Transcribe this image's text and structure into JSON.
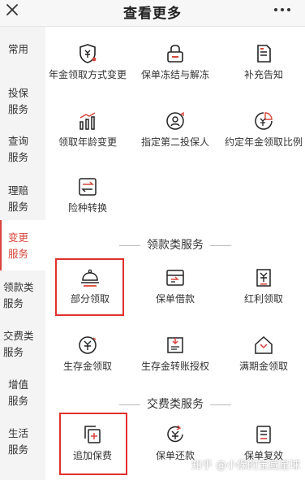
{
  "header": {
    "title": "查看更多"
  },
  "sidebar": {
    "items": [
      {
        "label": "常用"
      },
      {
        "label": "投保服务"
      },
      {
        "label": "查询服务"
      },
      {
        "label": "理赔服务"
      },
      {
        "label": "变更服务",
        "active": true
      },
      {
        "label": "领款类服务"
      },
      {
        "label": "交费类服务"
      },
      {
        "label": "增值服务"
      },
      {
        "label": "生活服务"
      }
    ]
  },
  "groups": {
    "change": [
      {
        "label": "年金领取方式变更",
        "icon": "yuan-shield-icon"
      },
      {
        "label": "保单冻结与解冻",
        "icon": "lock-icon"
      },
      {
        "label": "补充告知",
        "icon": "document-icon"
      },
      {
        "label": "领取年龄变更",
        "icon": "bar-chart-icon"
      },
      {
        "label": "指定第二投保人",
        "icon": "user-swap-icon"
      },
      {
        "label": "约定年金领取比例",
        "icon": "yuan-ratio-icon"
      },
      {
        "label": "险种转换",
        "icon": "convert-icon"
      }
    ],
    "payout_title": "领款类服务",
    "payout": [
      {
        "label": "部分领取",
        "icon": "bell-tray-icon",
        "highlighted": true
      },
      {
        "label": "保单借款",
        "icon": "loan-card-icon"
      },
      {
        "label": "红利领取",
        "icon": "yuan-receipt-icon"
      },
      {
        "label": "生存金领取",
        "icon": "yuan-coin-icon"
      },
      {
        "label": "生存金转账授权",
        "icon": "transfer-doc-icon"
      },
      {
        "label": "满期金领取",
        "icon": "yuan-house-icon"
      }
    ],
    "payment_title": "交费类服务",
    "payment": [
      {
        "label": "追加保费",
        "icon": "add-copy-icon",
        "highlighted": true
      },
      {
        "label": "保单还款",
        "icon": "yuan-refresh-icon"
      },
      {
        "label": "保单复效",
        "icon": "policy-restore-icon"
      }
    ]
  },
  "watermark": "知乎 @小保的宝藏星球",
  "colors": {
    "accent": "#d9453b",
    "highlight_border": "#e0312b"
  }
}
